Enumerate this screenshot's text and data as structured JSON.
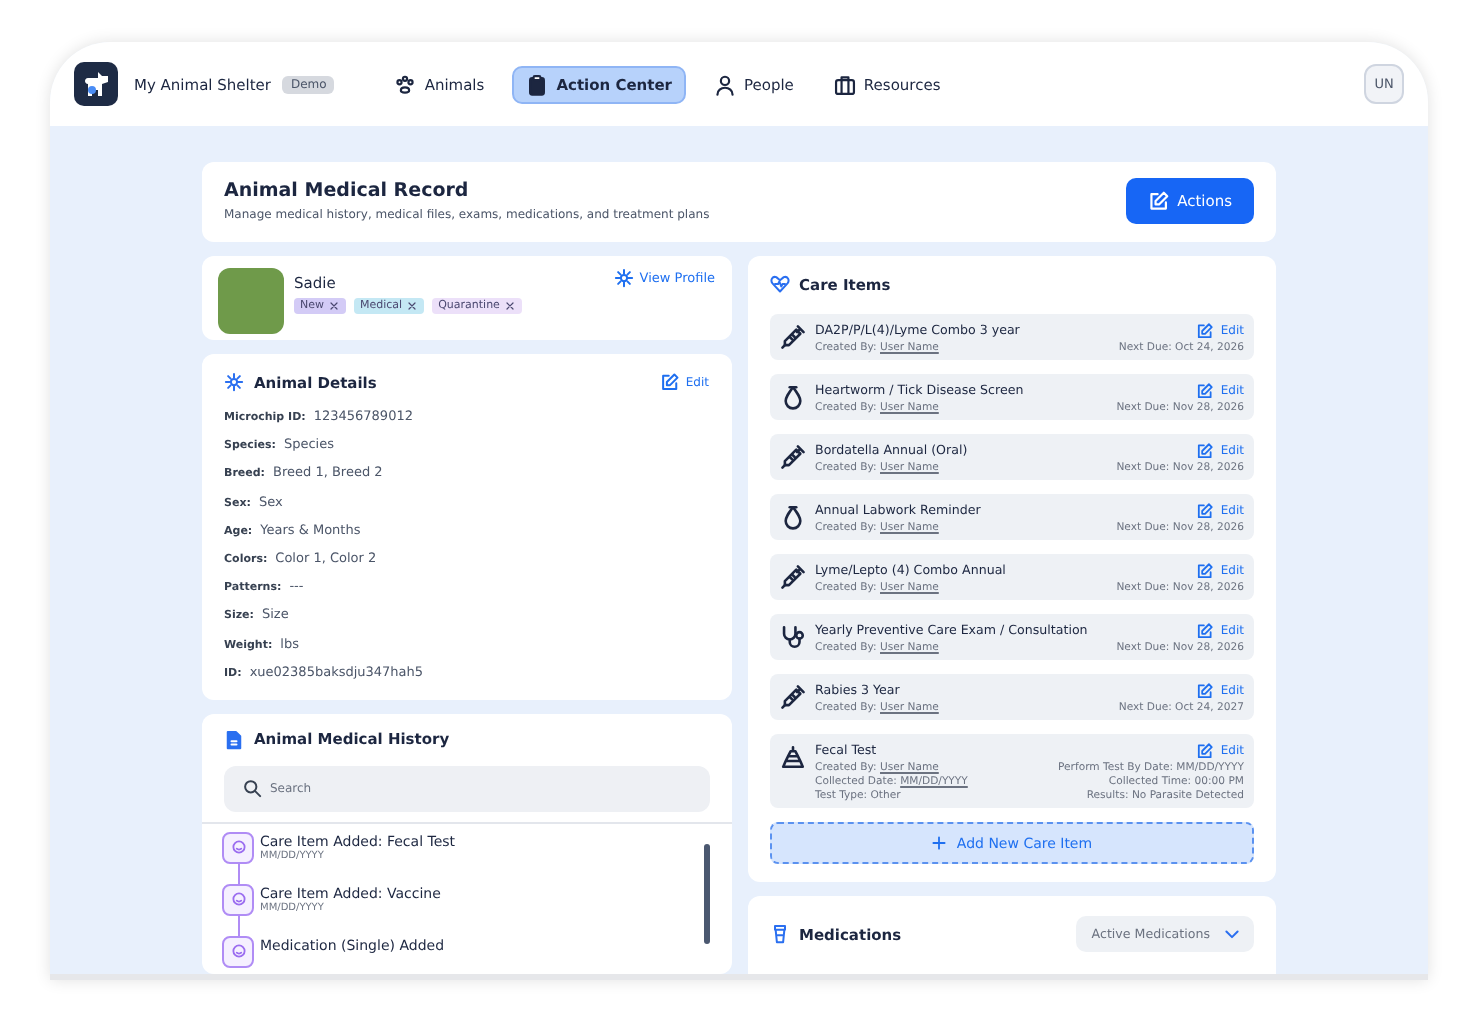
{
  "app": {
    "name": "My Animal Shelter",
    "badge": "Demo",
    "user_initials": "UN"
  },
  "nav": [
    {
      "label": "Animals",
      "selected": false
    },
    {
      "label": "Action Center",
      "selected": true
    },
    {
      "label": "People",
      "selected": false
    },
    {
      "label": "Resources",
      "selected": false
    }
  ],
  "page_header": {
    "title": "Animal Medical Record",
    "subtitle": "Manage medical history, medical files, exams, medications, and treatment plans",
    "action": "Actions"
  },
  "animal": {
    "name": "Sadie",
    "view_profile": "View Profile",
    "tags": [
      {
        "label": "New",
        "color": "#d3cbf6"
      },
      {
        "label": "Medical",
        "color": "#c4e8f4"
      },
      {
        "label": "Quarantine",
        "color": "#ece0f9"
      }
    ]
  },
  "details": {
    "title": "Animal Details",
    "edit": "Edit",
    "fields": [
      {
        "label": "Microchip ID:",
        "value": "123456789012"
      },
      {
        "label": "Species:",
        "value": "Species"
      },
      {
        "label": "Breed:",
        "value": "Breed 1, Breed 2"
      },
      {
        "label": "Sex:",
        "value": "Sex"
      },
      {
        "label": "Age:",
        "value": "Years & Months"
      },
      {
        "label": "Colors:",
        "value": "Color 1, Color 2"
      },
      {
        "label": "Patterns:",
        "value": "---"
      },
      {
        "label": "Size:",
        "value": "Size"
      },
      {
        "label": "Weight:",
        "value": "lbs"
      },
      {
        "label": "ID:",
        "value": "xue02385baksdju347hah5"
      }
    ]
  },
  "history": {
    "title": "Animal Medical History",
    "search": {
      "placeholder": "Search"
    },
    "entries": [
      {
        "title": "Care Item Added: Fecal Test",
        "date": "MM/DD/YYYY"
      },
      {
        "title": "Care Item Added: Vaccine",
        "date": "MM/DD/YYYY"
      },
      {
        "title": "Medication (Single) Added"
      }
    ]
  },
  "care_items": {
    "title": "Care Items",
    "add_button": "Add New Care Item",
    "items": [
      {
        "kind": "syringe",
        "name": "DA2P/P/L(4)/Lyme Combo 3 year",
        "edit": "Edit",
        "created_label": "Created By:",
        "created_by": "User Name",
        "due": "Next Due: Oct 24, 2026"
      },
      {
        "kind": "drop",
        "name": "Heartworm / Tick Disease Screen",
        "edit": "Edit",
        "created_label": "Created By:",
        "created_by": "User Name",
        "due": "Next Due: Nov 28, 2026"
      },
      {
        "kind": "syringe",
        "name": "Bordatella Annual (Oral)",
        "edit": "Edit",
        "created_label": "Created By:",
        "created_by": "User Name",
        "due": "Next Due: Nov 28, 2026"
      },
      {
        "kind": "drop",
        "name": "Annual Labwork Reminder",
        "edit": "Edit",
        "created_label": "Created By:",
        "created_by": "User Name",
        "due": "Next Due: Nov 28, 2026"
      },
      {
        "kind": "syringe",
        "name": "Lyme/Lepto (4) Combo Annual",
        "edit": "Edit",
        "created_label": "Created By:",
        "created_by": "User Name",
        "due": "Next Due: Nov 28, 2026"
      },
      {
        "kind": "stethoscope",
        "name": "Yearly Preventive Care Exam / Consultation",
        "edit": "Edit",
        "created_label": "Created By:",
        "created_by": "User Name",
        "due": "Next Due: Nov 28, 2026"
      },
      {
        "kind": "syringe",
        "name": "Rabies 3 Year",
        "edit": "Edit",
        "created_label": "Created By:",
        "created_by": "User Name",
        "due": "Next Due: Oct 24, 2027"
      },
      {
        "kind": "test",
        "name": "Fecal Test",
        "edit": "Edit",
        "created_label": "Created By:",
        "created_by": "User Name",
        "due": "Perform Test By Date: MM/DD/YYYY",
        "collected_label": "Collected Date:",
        "collected_date": "MM/DD/YYYY",
        "collected_time": "Collected Time: 00:00 PM",
        "test_type": "Test Type: Other",
        "results": "Results: No Parasite Detected"
      }
    ]
  },
  "medications": {
    "title": "Medications",
    "filter": "Active Medications"
  }
}
